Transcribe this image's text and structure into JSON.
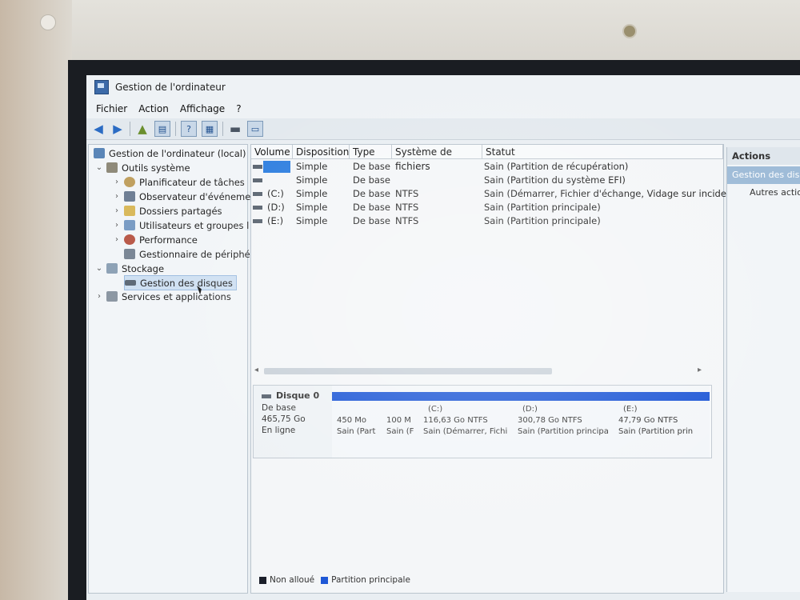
{
  "window": {
    "title": "Gestion de l'ordinateur"
  },
  "menu": [
    "Fichier",
    "Action",
    "Affichage",
    "?"
  ],
  "toolbar": {
    "icons": [
      "back-arrow-icon",
      "forward-arrow-icon",
      "up-folder-icon",
      "show-hide-tree-icon",
      "help-icon",
      "properties-icon",
      "disk-icon",
      "console-icon"
    ]
  },
  "tree": {
    "root": "Gestion de l'ordinateur (local)",
    "system_tools": "Outils système",
    "items": [
      "Planificateur de tâches",
      "Observateur d'événeme",
      "Dossiers partagés",
      "Utilisateurs et groupes l",
      "Performance",
      "Gestionnaire de périphé"
    ],
    "storage": "Stockage",
    "disk_management": "Gestion des disques",
    "services": "Services et applications"
  },
  "volumes": {
    "headers": [
      "Volume",
      "Disposition",
      "Type",
      "Système de fichiers",
      "Statut"
    ],
    "rows": [
      {
        "volume": "",
        "layout": "Simple",
        "type": "De base",
        "fs": "",
        "status": "Sain (Partition de récupération)"
      },
      {
        "volume": "",
        "layout": "Simple",
        "type": "De base",
        "fs": "",
        "status": "Sain (Partition du système EFI)"
      },
      {
        "volume": "(C:)",
        "layout": "Simple",
        "type": "De base",
        "fs": "NTFS",
        "status": "Sain (Démarrer, Fichier d'échange, Vidage sur incident, P"
      },
      {
        "volume": "(D:)",
        "layout": "Simple",
        "type": "De base",
        "fs": "NTFS",
        "status": "Sain (Partition principale)"
      },
      {
        "volume": "(E:)",
        "layout": "Simple",
        "type": "De base",
        "fs": "NTFS",
        "status": "Sain (Partition principale)"
      }
    ]
  },
  "disk": {
    "name": "Disque 0",
    "kind": "De base",
    "size": "465,75 Go",
    "state": "En ligne",
    "partitions": [
      {
        "label": "",
        "size": "450 Mo",
        "status": "Sain (Part"
      },
      {
        "label": "",
        "size": "100 M",
        "status": "Sain (F"
      },
      {
        "label": "(C:)",
        "size": "116,63 Go NTFS",
        "status": "Sain (Démarrer, Fichi"
      },
      {
        "label": "(D:)",
        "size": "300,78 Go NTFS",
        "status": "Sain (Partition principa"
      },
      {
        "label": "(E:)",
        "size": "47,79 Go NTFS",
        "status": "Sain (Partition prin"
      }
    ]
  },
  "legend": {
    "unallocated": "Non alloué",
    "primary": "Partition principale"
  },
  "actions": {
    "title": "Actions",
    "section": "Gestion des disq",
    "other": "Autres actio"
  },
  "colors": {
    "partition_bar": "#1f58d6",
    "unallocated": "#1b1f2a",
    "selection": "#2f7fe0"
  }
}
